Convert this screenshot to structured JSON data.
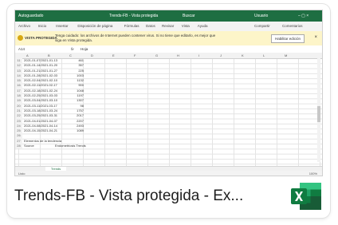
{
  "caption": "Trends-FB  -  Vista protegida - Ex...",
  "window": {
    "autosave": "Autoguardado",
    "title": "Trends-FB - Vista protegida",
    "search": "Buscar",
    "user": "Usuario",
    "tabs": [
      "Archivo",
      "Inicio",
      "Insertar",
      "Disposición de página",
      "Fórmulas",
      "Datos",
      "Revisar",
      "Vista",
      "Ayuda"
    ],
    "share": "Compartir",
    "comments": "Comentarios"
  },
  "protected_view": {
    "label": "VISTA PROTEGIDA",
    "message": "Tenga cuidado: los archivos de Internet pueden contener virus. Si no tiene que editarlo, es mejor que siga en Vista protegida.",
    "enable_button": "Habilitar edición",
    "close": "×"
  },
  "formula_bar": {
    "cell_ref": "A14",
    "fx": "fx",
    "content": "Hoja"
  },
  "columns": [
    "A",
    "B",
    "C",
    "D",
    "E",
    "F",
    "G",
    "H",
    "I",
    "J",
    "K",
    "L",
    "M"
  ],
  "rows": [
    {
      "n": "11",
      "date": "2021-01-07/2021-01-13",
      "value": "461"
    },
    {
      "n": "12",
      "date": "2021-01-14/2021-01-20",
      "value": "357"
    },
    {
      "n": "13",
      "date": "2021-01-21/2021-01-27",
      "value": "225"
    },
    {
      "n": "14",
      "date": "2021-01-28/2021-02-03",
      "value": "1003"
    },
    {
      "n": "15",
      "date": "2021-02-04/2021-02-10",
      "value": "1132"
    },
    {
      "n": "16",
      "date": "2021-02-11/2021-02-17",
      "value": "900"
    },
    {
      "n": "17",
      "date": "2021-02-18/2021-02-24",
      "value": "1048"
    },
    {
      "n": "18",
      "date": "2021-02-25/2021-03-03",
      "value": "1197"
    },
    {
      "n": "19",
      "date": "2021-03-04/2021-03-10",
      "value": "1307"
    },
    {
      "n": "20",
      "date": "2021-03-11/2021-03-17",
      "value": "98"
    },
    {
      "n": "21",
      "date": "2021-03-18/2021-03-24",
      "value": "1757"
    },
    {
      "n": "22",
      "date": "2021-03-25/2021-03-31",
      "value": "2017"
    },
    {
      "n": "23",
      "date": "2021-04-01/2021-04-07",
      "value": "2207"
    },
    {
      "n": "24",
      "date": "2021-04-08/2021-04-14",
      "value": "2493"
    },
    {
      "n": "25",
      "date": "2021-04-15/2021-04-21",
      "value": "1089"
    },
    {
      "n": "26",
      "date": "",
      "value": ""
    },
    {
      "n": "27",
      "date": "Elementos de la tendencia",
      "value": ""
    },
    {
      "n": "28",
      "date": "Source",
      "value": "Endometriosis Trends"
    }
  ],
  "sheet_tab": "Trends",
  "status": {
    "left": "Listo",
    "zoom": "100%"
  },
  "colors": {
    "excel_green": "#1e6e42",
    "pv_yellow": "#fdf5c9"
  },
  "icon": "excel-icon"
}
